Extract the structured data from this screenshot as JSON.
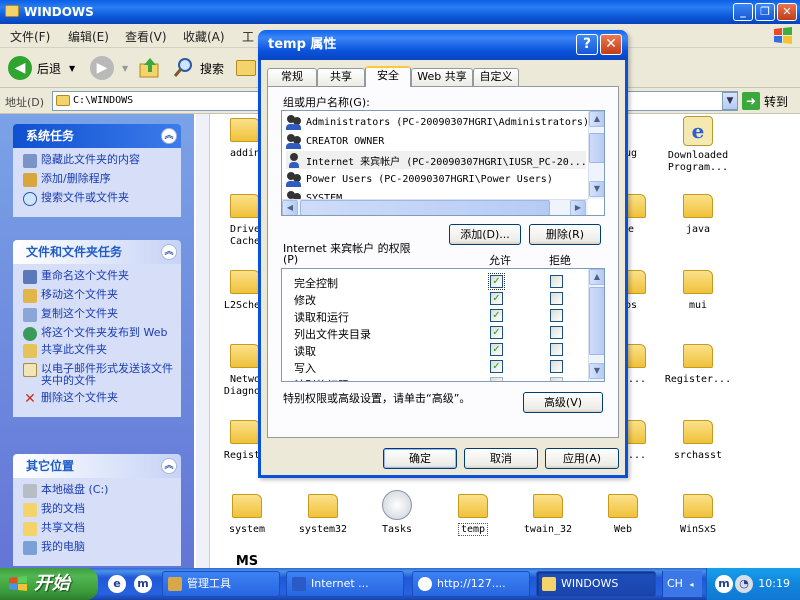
{
  "explorer": {
    "title": "WINDOWS",
    "menu": [
      "文件(F)",
      "编辑(E)",
      "查看(V)",
      "收藏(A)",
      "工"
    ],
    "toolbar": {
      "back": "后退",
      "search": "搜索"
    },
    "address_label": "地址(D)",
    "address_value": "C:\\WINDOWS",
    "go_label": "转到",
    "task_panels": {
      "system_tasks": {
        "title": "系统任务",
        "items": [
          "隐藏此文件夹的内容",
          "添加/删除程序",
          "搜索文件或文件夹"
        ]
      },
      "file_tasks": {
        "title": "文件和文件夹任务",
        "items": [
          "重命名这个文件夹",
          "移动这个文件夹",
          "复制这个文件夹",
          "将这个文件夹发布到 Web",
          "共享此文件夹",
          "以电子邮件形式发送该文件夹中的文件",
          "删除这个文件夹"
        ]
      },
      "other_places": {
        "title": "其它位置",
        "items": [
          "本地磁盘 (C:)",
          "我的文档",
          "共享文档",
          "我的电脑"
        ]
      }
    },
    "files": {
      "addins": "addin",
      "debug": "ug",
      "downloaded1": "Downloaded",
      "downloaded2": "Program...",
      "driver1": "Drive",
      "driver2": "Cache",
      "ime": "e",
      "java": "java",
      "l2schema": "L2Schem",
      "apppatch": "ps",
      "mui": "mui",
      "network1": "Netwo",
      "network2": "Diagnos",
      "radio": "io...",
      "registered": "Register...",
      "registration": "Registr",
      "resources": "re...",
      "srchasst": "srchasst",
      "system": "system",
      "system32": "system32",
      "tasks": "Tasks",
      "temp": "temp",
      "twain32": "twain_32",
      "web": "Web",
      "winsxs": "WinSxS",
      "ms": "MS"
    }
  },
  "dialog": {
    "title": "temp 属性",
    "help_button": "?",
    "close_button": "✕",
    "tabs": [
      "常规",
      "共享",
      "安全",
      "Web 共享",
      "自定义"
    ],
    "active_tab": "安全",
    "group_label": "组或用户名称(G):",
    "users": [
      "Administrators (PC-20090307HGRI\\Administrators)",
      "CREATOR OWNER",
      "Internet 来宾帐户 (PC-20090307HGRI\\IUSR_PC-20...)",
      "Power Users (PC-20090307HGRI\\Power Users)",
      "SYSTEM"
    ],
    "add_button": "添加(D)...",
    "remove_button": "删除(R)",
    "perm_label_line1": "Internet 来宾帐户 的权限",
    "perm_label_line2": "(P)",
    "allow_header": "允许",
    "deny_header": "拒绝",
    "permissions": [
      {
        "name": "完全控制",
        "allow": true,
        "deny": false
      },
      {
        "name": "修改",
        "allow": true,
        "deny": false
      },
      {
        "name": "读取和运行",
        "allow": true,
        "deny": false
      },
      {
        "name": "列出文件夹目录",
        "allow": true,
        "deny": false
      },
      {
        "name": "读取",
        "allow": true,
        "deny": false
      },
      {
        "name": "写入",
        "allow": true,
        "deny": false
      },
      {
        "name": "特别的权限",
        "allow": false,
        "deny": false
      }
    ],
    "special_note": "特别权限或高级设置，请单击“高级”。",
    "advanced_button": "高级(V)",
    "ok_button": "确定",
    "cancel_button": "取消",
    "apply_button": "应用(A)"
  },
  "taskbar": {
    "start_label": "开始",
    "buttons": [
      "管理工具",
      "Internet ...",
      "http://127....",
      "WINDOWS"
    ],
    "language": "CH",
    "clock": "10:19"
  },
  "colors": {
    "xp_blue": "#0a52dc",
    "start_green": "#3a9a3a",
    "link_blue": "#1a3cb0",
    "check_green": "#21a121"
  }
}
